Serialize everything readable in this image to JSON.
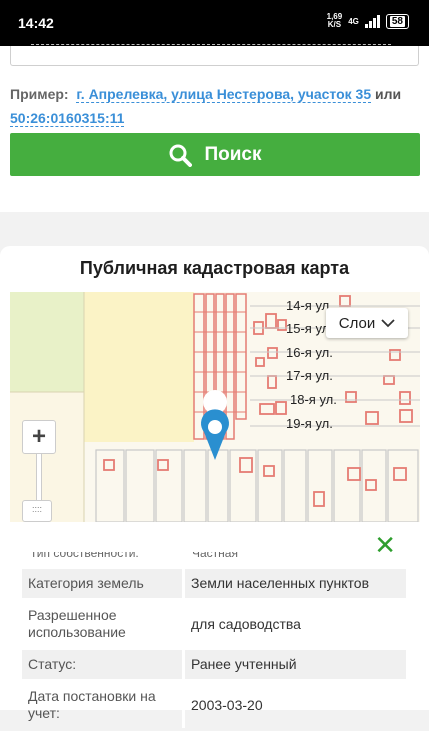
{
  "status_bar": {
    "time": "14:42",
    "speed_value": "1,69",
    "speed_unit": "K/S",
    "network": "4G",
    "battery": "58"
  },
  "search": {
    "example_label": "Пример:",
    "example_address": "г. Апрелевка, улица Нестерова, участок 35",
    "example_or": "или",
    "example_number": "50:26:0160315:11",
    "button_label": "Поиск"
  },
  "map_card": {
    "title": "Публичная кадастровая карта",
    "layers_label": "Слои",
    "zoom_in": "+",
    "streets": [
      "14-я ул.",
      "15-я ул.",
      "16-я ул.",
      "17-я ул.",
      "18-я ул.",
      "19-я ул."
    ]
  },
  "info": {
    "close": "✕",
    "cut_key": "Тип собственности:",
    "cut_value": "Частная",
    "rows": [
      {
        "key": "Категория земель",
        "value": "Земли населенных пунктов"
      },
      {
        "key": "Разрешенное использование",
        "value": "для садоводства"
      },
      {
        "key": "Статус:",
        "value": "Ранее учтенный"
      },
      {
        "key": "Дата постановки на учет:",
        "value": "2003-03-20"
      }
    ]
  },
  "colors": {
    "accent": "#45ae3f",
    "link": "#3a8fd8",
    "parcel_outline": "#e57c73"
  }
}
